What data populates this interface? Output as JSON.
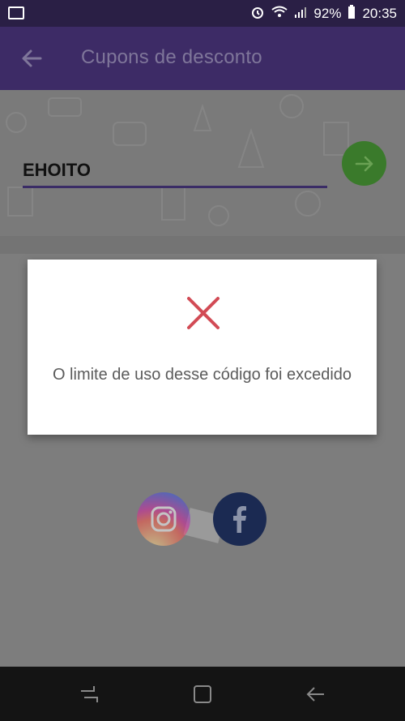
{
  "status_bar": {
    "battery_percent": "92%",
    "time": "20:35"
  },
  "app_bar": {
    "title": "Cupons de desconto"
  },
  "coupon": {
    "code_value": "EHOITO"
  },
  "dialog": {
    "message": "O limite de uso desse código foi excedido"
  },
  "colors": {
    "app_bar": "#3d2b66",
    "status_bar": "#2a1f45",
    "submit_button": "#3a7a2b",
    "error_x": "#d24b55",
    "facebook": "#1b2a52"
  },
  "icons": {
    "back": "arrow-left-icon",
    "submit": "arrow-right-icon",
    "error": "close-icon",
    "instagram": "instagram-icon",
    "facebook": "facebook-icon"
  }
}
